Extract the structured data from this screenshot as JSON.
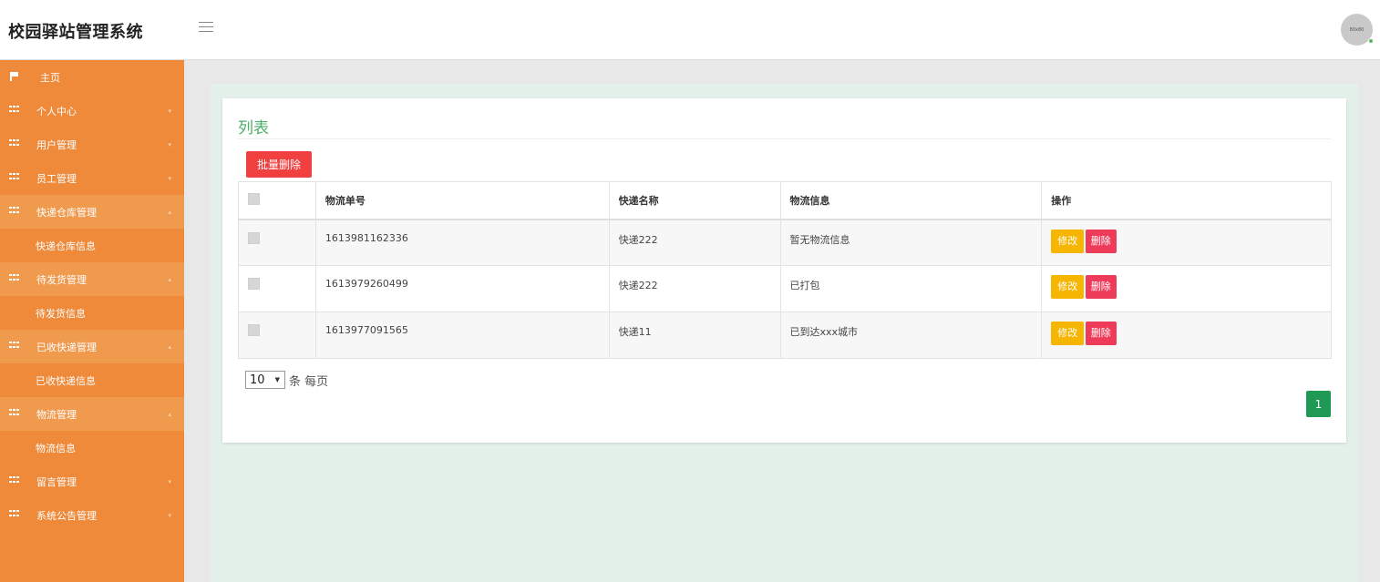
{
  "header": {
    "brand": "校园驿站管理系统",
    "avatar_text": "80x80"
  },
  "sidebar": {
    "home": "主页",
    "items": [
      {
        "label": "个人中心",
        "open": false
      },
      {
        "label": "用户管理",
        "open": false
      },
      {
        "label": "员工管理",
        "open": false
      },
      {
        "label": "快递仓库管理",
        "open": true,
        "sub": "快递仓库信息"
      },
      {
        "label": "待发货管理",
        "open": true,
        "sub": "待发货信息"
      },
      {
        "label": "已收快递管理",
        "open": true,
        "sub": "已收快递信息"
      },
      {
        "label": "物流管理",
        "open": true,
        "sub": "物流信息"
      },
      {
        "label": "留言管理",
        "open": false
      },
      {
        "label": "系统公告管理",
        "open": false
      }
    ]
  },
  "panel": {
    "title": "列表",
    "batch_delete": "批量删除"
  },
  "table": {
    "headers": [
      "物流单号",
      "快递名称",
      "物流信息",
      "操作"
    ],
    "rows": [
      [
        "1613981162336",
        "快递222",
        "暂无物流信息"
      ],
      [
        "1613979260499",
        "快递222",
        "已打包"
      ],
      [
        "1613977091565",
        "快递11",
        "已到达xxx城市"
      ]
    ],
    "edit_label": "修改",
    "delete_label": "删除"
  },
  "pagination": {
    "page_size": "10",
    "unit": "条 每页",
    "current_page": "1"
  },
  "colors": {
    "sidebar": "#ee8a3a",
    "accent_green": "#4cae6a",
    "delete_red": "#ee3b5a",
    "edit_yellow": "#f6b500"
  }
}
